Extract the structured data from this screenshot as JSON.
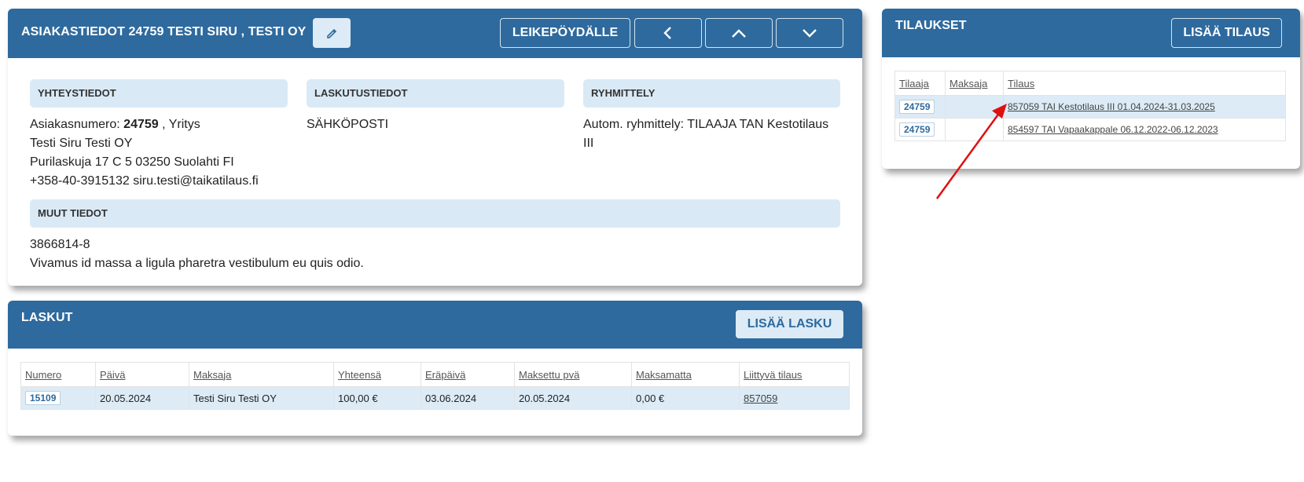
{
  "customer": {
    "title": "ASIAKASTIEDOT 24759 TESTI SIRU , TESTI OY",
    "clipboard_label": "LEIKEPÖYDÄLLE",
    "sections": {
      "contact_title": "YHTEYSTIEDOT",
      "billing_title": "LASKUTUSTIEDOT",
      "grouping_title": "RYHMITTELY",
      "other_title": "MUUT TIEDOT"
    },
    "contact": {
      "number_label": "Asiakasnumero:",
      "number_value": "24759",
      "number_suffix": ", Yritys",
      "name": "Testi Siru Testi OY",
      "address": "Purilaskuja 17 C 5 03250 Suolahti FI",
      "phone_email": "+358-40-3915132 siru.testi@taikatilaus.fi"
    },
    "billing": {
      "method": "SÄHKÖPOSTI"
    },
    "grouping": {
      "line1": "Autom. ryhmittely: TILAAJA TAN Kestotilaus",
      "line2": "III"
    },
    "other": {
      "line1": "3866814-8",
      "line2": "Vivamus id massa a ligula pharetra vestibulum eu quis odio."
    }
  },
  "invoices": {
    "title": "LASKUT",
    "add_label": "LISÄÄ LASKU",
    "headers": [
      "Numero",
      "Päivä",
      "Maksaja",
      "Yhteensä",
      "Eräpäivä",
      "Maksettu pvä",
      "Maksamatta",
      "Liittyvä tilaus"
    ],
    "row": {
      "number": "15109",
      "date": "20.05.2024",
      "payer": "Testi Siru Testi OY",
      "total": "100,00 €",
      "due": "03.06.2024",
      "paid": "20.05.2024",
      "unpaid": "0,00 €",
      "order": "857059"
    }
  },
  "orders": {
    "title": "TILAUKSET",
    "add_label": "LISÄÄ TILAUS",
    "headers": [
      "Tilaaja",
      "Maksaja",
      "Tilaus"
    ],
    "rows": [
      {
        "orderer": "24759",
        "payer": "",
        "order": "857059 TAI Kestotilaus III 01.04.2024-31.03.2025"
      },
      {
        "orderer": "24759",
        "payer": "",
        "order": "854597 TAI Vapaakappale 06.12.2022-06.12.2023"
      }
    ]
  },
  "colors": {
    "header": "#2e6a9e",
    "section": "#d9eaf6",
    "arrow": "#e01010"
  }
}
